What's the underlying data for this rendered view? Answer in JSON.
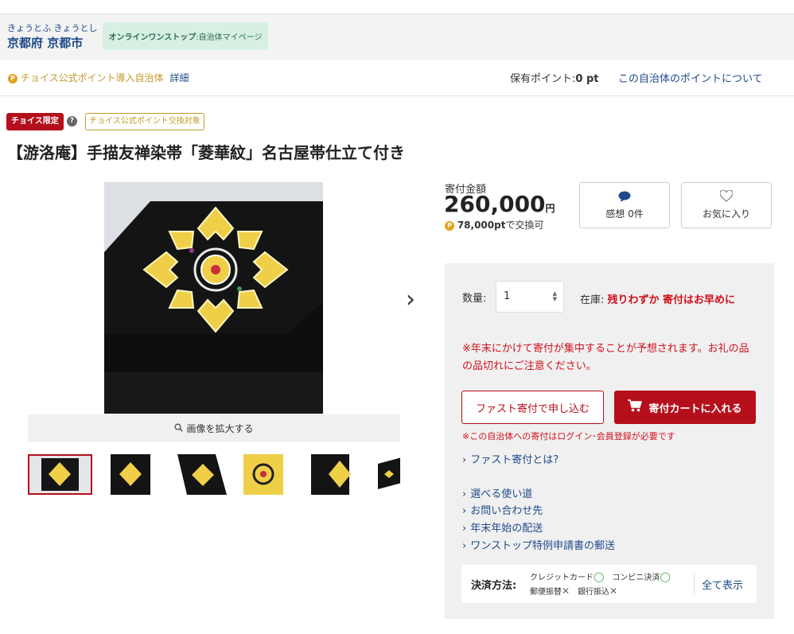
{
  "header": {
    "municipality_kana": "きょうとふ きょうとし",
    "municipality_name": "京都府 京都市",
    "onestop_label_bold": "オンラインワンストップ",
    "onestop_label_rest": ":自治体マイページ"
  },
  "point_bar": {
    "icon": "point-coin-icon",
    "official_label": "チョイス公式ポイント導入自治体",
    "detail_link": "詳細",
    "holding_label": "保有ポイント:",
    "holding_value": "0 pt",
    "about_link": "この自治体のポイントについて"
  },
  "badges": {
    "limited": "チョイス限定",
    "help_icon": "question-icon",
    "exchange": "チョイス公式ポイント交換対象"
  },
  "product": {
    "title": "【游洛庵】手描友禅染帯「菱華紋」名古屋帯仕立て付き",
    "zoom_label": "画像を拡大する",
    "thumbnail_count": 6
  },
  "price": {
    "label": "寄付金額",
    "amount": "260,000",
    "unit": "円",
    "points": "78,000pt",
    "points_suffix": "で交換可"
  },
  "actions": {
    "review_label": "感想 0件",
    "favorite_label": "お気に入り"
  },
  "order_panel": {
    "quantity_label": "数量:",
    "quantity_value": "1",
    "stock_label": "在庫:",
    "stock_warning": "残りわずか 寄付はお早めに",
    "notice": "※年末にかけて寄付が集中することが予想されます。お礼の品の品切れにご注意ください。",
    "fast_button": "ファスト寄付で申し込む",
    "cart_button": "寄付カートに入れる",
    "login_note": "※この自治体への寄付はログイン･会員登録が必要です",
    "links": [
      "ファスト寄付とは?",
      "選べる使い道",
      "お問い合わせ先",
      "年末年始の配送",
      "ワンストップ特例申請書の郵送"
    ]
  },
  "payment": {
    "label": "決済方法:",
    "methods": [
      {
        "name": "クレジットカード",
        "mark": "◯"
      },
      {
        "name": "コンビニ決済",
        "mark": "◯"
      },
      {
        "name": "郵便振替",
        "mark": "✕"
      },
      {
        "name": "銀行振込",
        "mark": "✕"
      }
    ],
    "show_all": "全て表示"
  },
  "colors": {
    "brand_red": "#b50f1c",
    "link_blue": "#1f4a8a",
    "point_gold": "#c49a28"
  }
}
